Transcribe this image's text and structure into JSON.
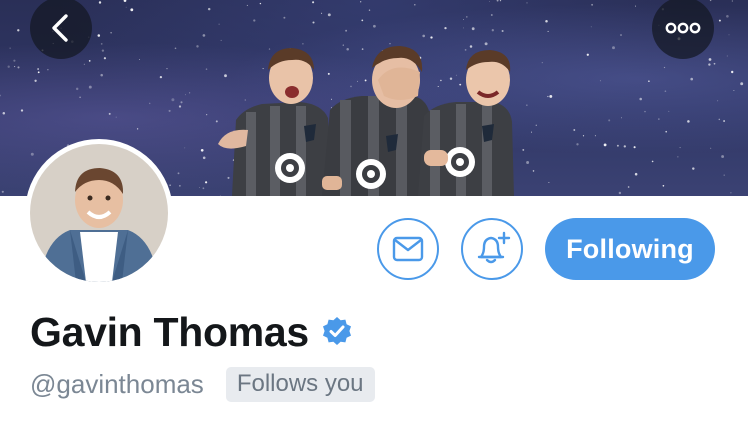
{
  "profile": {
    "display_name": "Gavin Thomas",
    "handle": "@gavinthomas",
    "follows_you_badge": "Follows you",
    "verified": true
  },
  "actions": {
    "following_label": "Following"
  },
  "icons": {
    "back": "chevron-left-icon",
    "more": "more-horizontal-icon",
    "message": "envelope-icon",
    "notifications": "bell-plus-icon",
    "verified": "verified-badge-icon"
  },
  "colors": {
    "accent": "#4a99e9",
    "name": "#14171a",
    "handle": "#7b8794",
    "badge_bg": "#e8ebef",
    "banner_bg": "#2f3663"
  }
}
